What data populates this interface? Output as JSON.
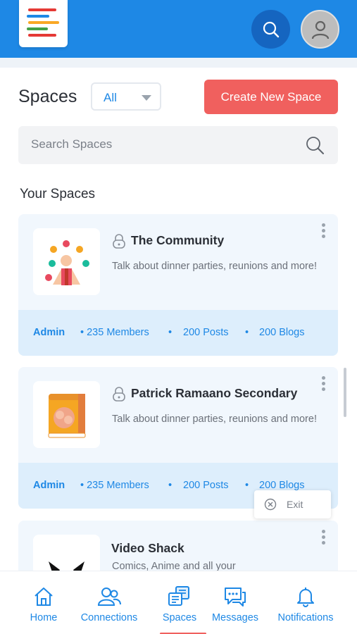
{
  "header": {
    "logo_colors": [
      "#e53935",
      "#1e88e5",
      "#f9a825",
      "#43a047",
      "#e53935"
    ],
    "search_icon": "search-icon",
    "avatar_icon": "user-avatar-icon"
  },
  "page": {
    "title": "Spaces",
    "filter": {
      "selected": "All"
    },
    "create_button": "Create New Space",
    "search_placeholder": "Search Spaces",
    "section_title": "Your Spaces"
  },
  "spaces": [
    {
      "name": "The Community",
      "description": "Talk about dinner parties, reunions and more!",
      "role": "Admin",
      "members": "• 235 Members",
      "posts": "200 Posts",
      "blogs": "200 Blogs",
      "thumbnail_icon": "juggler-icon"
    },
    {
      "name": "Patrick Ramaano Secondary",
      "description": "Talk about dinner parties, reunions and more!",
      "role": "Admin",
      "members": "• 235 Members",
      "posts": "200 Posts",
      "blogs": "200 Blogs",
      "thumbnail_icon": "brain-book-icon"
    },
    {
      "name": "Video Shack",
      "description": "Comics, Anime and all your",
      "thumbnail_icon": "video-character-icon"
    }
  ],
  "separator": "•",
  "toast": {
    "label": "Exit"
  },
  "nav": {
    "items": [
      {
        "label": "Home",
        "icon": "home-icon"
      },
      {
        "label": "Connections",
        "icon": "connections-icon"
      },
      {
        "label": "Spaces",
        "icon": "spaces-icon"
      },
      {
        "label": "Messages",
        "icon": "messages-icon"
      },
      {
        "label": "Notifications",
        "icon": "bell-icon"
      }
    ],
    "active": "Spaces"
  },
  "colors": {
    "brand_blue": "#1e88e5",
    "accent_red": "#f0605e",
    "card_bg": "#f1f7fd",
    "card_footer_bg": "#ddeefc"
  }
}
